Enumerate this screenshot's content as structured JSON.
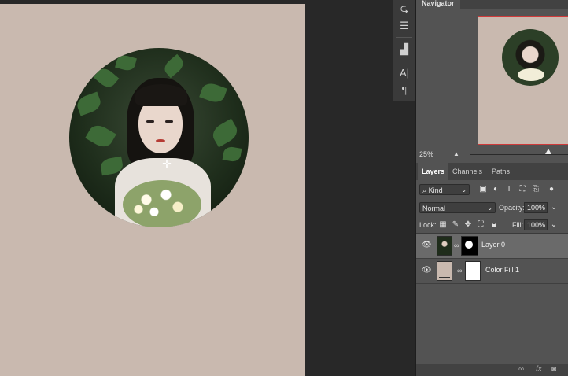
{
  "navigator": {
    "tab_label": "Navigator",
    "zoom": "25%",
    "zoom_slider_fraction": 0.8
  },
  "tool_strip": {
    "items": [
      {
        "icon": "history-brush-icon",
        "glyph": "⮎"
      },
      {
        "icon": "adjustments-icon",
        "glyph": "☰"
      },
      {
        "icon": "histogram-icon",
        "glyph": "▟"
      },
      {
        "icon": "character-icon",
        "glyph": "A|"
      },
      {
        "icon": "paragraph-icon",
        "glyph": "¶"
      }
    ]
  },
  "layers_panel": {
    "tabs": [
      {
        "label": "Layers",
        "active": true
      },
      {
        "label": "Channels",
        "active": false
      },
      {
        "label": "Paths",
        "active": false
      }
    ],
    "filter_kind": "Kind",
    "blend_mode": "Normal",
    "opacity_label": "Opacity:",
    "opacity_value": "100%",
    "lock_label": "Lock:",
    "fill_label": "Fill:",
    "fill_value": "100%",
    "layers": [
      {
        "name": "Layer 0",
        "selected": true,
        "visible": true
      },
      {
        "name": "Color Fill 1",
        "selected": false,
        "visible": true
      }
    ],
    "footer_icons": [
      "link-icon",
      "fx-icon",
      "add-mask-icon"
    ]
  },
  "colors": {
    "document_background": "#c9b9af",
    "selected_layer": "#6a6a6a",
    "navigator_frame": "#d03a3a"
  }
}
